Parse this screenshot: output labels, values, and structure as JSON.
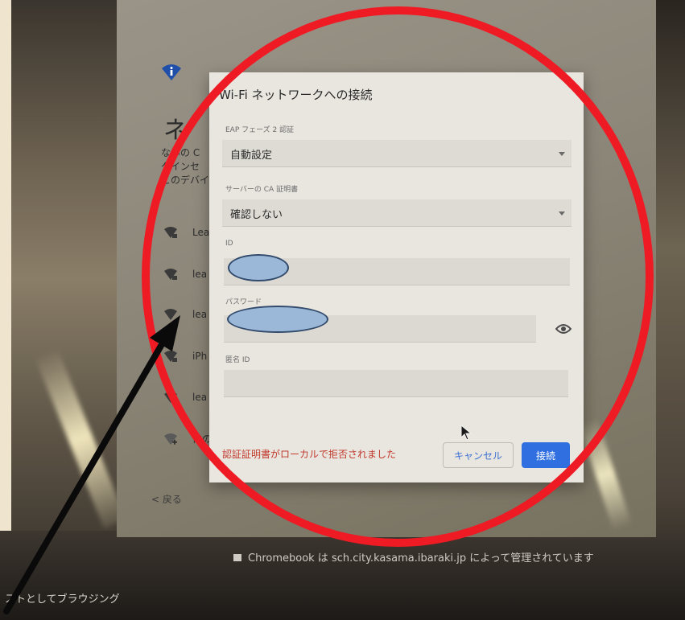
{
  "screen": {
    "heading_partial": "ネ",
    "description_lines": [
      "ないの C",
      "グインセ",
      "このデバイ"
    ],
    "networks": [
      {
        "label": "Lea"
      },
      {
        "label": "lea"
      },
      {
        "label": "lea"
      },
      {
        "label": "iPh"
      },
      {
        "label": "lea"
      },
      {
        "label": "他の"
      }
    ],
    "back_label": "< 戻る",
    "managed_note": "Chromebook は sch.city.kasama.ibaraki.jp によって管理されています",
    "guest_browse": "ストとしてブラウジング"
  },
  "dialog": {
    "title": "Wi-Fi ネットワークへの接続",
    "eap_phase2": {
      "label": "EAP フェーズ 2 認証",
      "value": "自動設定"
    },
    "server_ca": {
      "label": "サーバーの CA 証明書",
      "value": "確認しない"
    },
    "identity": {
      "label": "ID",
      "value": ""
    },
    "password": {
      "label": "パスワード",
      "value": ""
    },
    "anonymous_id": {
      "label": "匿名 ID",
      "value": ""
    },
    "error": "認証証明書がローカルで拒否されました",
    "cancel_label": "キャンセル",
    "connect_label": "接続"
  },
  "icons": [
    "wifi-logo-icon",
    "wifi-lock-icon",
    "eye-icon",
    "mouse-cursor-icon",
    "building-icon"
  ],
  "colors": {
    "annotation_circle": "#ee1b24",
    "redaction": "#9bb8d8",
    "connect_button": "#2f6fe0",
    "error_text": "#c0392b"
  }
}
